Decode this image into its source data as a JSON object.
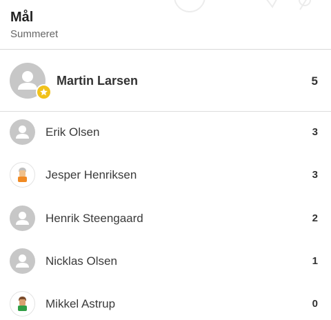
{
  "header": {
    "title": "Mål",
    "subtitle": "Summeret"
  },
  "top_scorer": {
    "name": "Martin Larsen",
    "value": "5",
    "avatar_icon": "default-avatar-icon",
    "badge_icon": "star-icon",
    "badge_color": "#f1c21b"
  },
  "players": [
    {
      "name": "Erik Olsen",
      "value": "3",
      "avatar_icon": "default-avatar-icon"
    },
    {
      "name": "Jesper Henriksen",
      "value": "3",
      "avatar_icon": "player-avatar-icon"
    },
    {
      "name": "Henrik Steengaard",
      "value": "2",
      "avatar_icon": "default-avatar-icon"
    },
    {
      "name": "Nicklas Olsen",
      "value": "1",
      "avatar_icon": "default-avatar-icon"
    },
    {
      "name": "Mikkel Astrup",
      "value": "0",
      "avatar_icon": "player-avatar-icon"
    }
  ]
}
